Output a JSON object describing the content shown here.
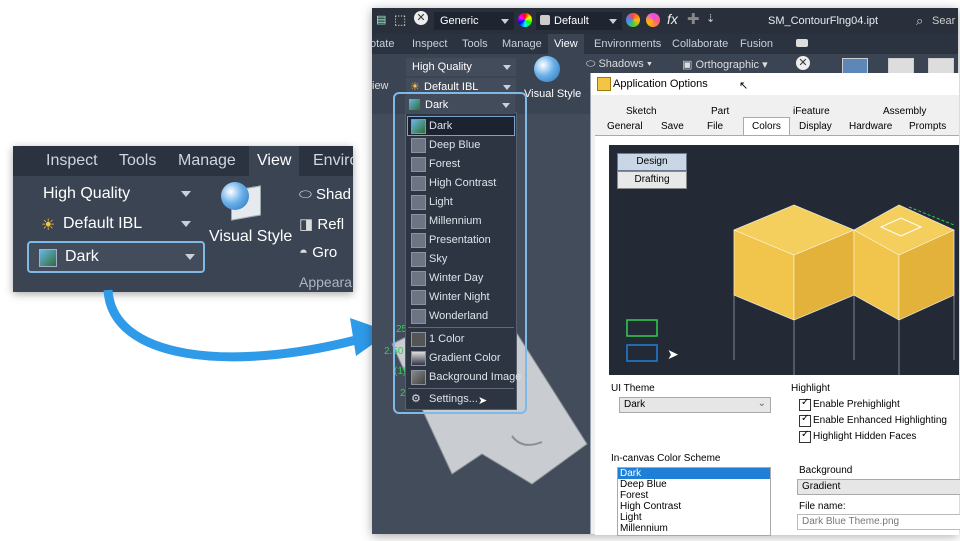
{
  "zoom": {
    "tabs": [
      "Inspect",
      "Tools",
      "Manage",
      "View",
      "Enviro"
    ],
    "active_tab": "View",
    "quality": "High Quality",
    "lighting": "Default IBL",
    "style": "Dark",
    "visual_style": "Visual Style",
    "side_items": [
      "Shad",
      "Refl",
      "Gro"
    ],
    "panel_label": "Appeara"
  },
  "app": {
    "qat": {
      "material": "Generic",
      "appearance": "Default",
      "fx": "fx",
      "title": "SM_ContourFlng04.ipt",
      "search": "Sear"
    },
    "ribbon_tabs": [
      "otate",
      "Inspect",
      "Tools",
      "Manage",
      "View",
      "Environments",
      "Collaborate",
      "Fusion"
    ],
    "active_tab": "View",
    "ribbon": {
      "quality": "High Quality",
      "lighting": "Default IBL",
      "style": "Dark",
      "visual_style_line1": "Visual Style",
      "view_stub": "iew",
      "shadows": "Shadows",
      "orthographic": "Orthographic"
    },
    "style_list": [
      "Dark",
      "Deep Blue",
      "Forest",
      "High Contrast",
      "Light",
      "Millennium",
      "Presentation",
      "Sky",
      "Winter Day",
      "Winter Night",
      "Wonderland"
    ],
    "background_list": [
      "1 Color",
      "Gradient Color",
      "Background Image"
    ],
    "settings": "Settings...",
    "canvas_numbers": [
      "25",
      "2.50",
      "(1)",
      "2"
    ]
  },
  "dialog": {
    "title": "Application Options",
    "tabs_row1": [
      "Sketch",
      "Part",
      "iFeature",
      "Assembly"
    ],
    "tabs_row2": [
      "General",
      "Save",
      "File",
      "Colors",
      "Display",
      "Hardware",
      "Prompts"
    ],
    "active_tab": "Colors",
    "preview_buttons": [
      "Design",
      "Drafting"
    ],
    "ui_theme_label": "UI Theme",
    "ui_theme_value": "Dark",
    "highlight_label": "Highlight",
    "highlight_options": [
      "Enable Prehighlight",
      "Enable Enhanced Highlighting",
      "Highlight Hidden Faces"
    ],
    "scheme_label": "In-canvas Color Scheme",
    "schemes": [
      "Dark",
      "Deep Blue",
      "Forest",
      "High Contrast",
      "Light",
      "Millennium"
    ],
    "background_label": "Background",
    "background_value": "Gradient",
    "file_name_label": "File name:",
    "file_name_value": "Dark Blue Theme.png"
  },
  "colors": {
    "accent": "#7fb9e6",
    "arrow": "#2f9be8",
    "cube": "#f1c44b",
    "selected": "#1f7fd6"
  }
}
